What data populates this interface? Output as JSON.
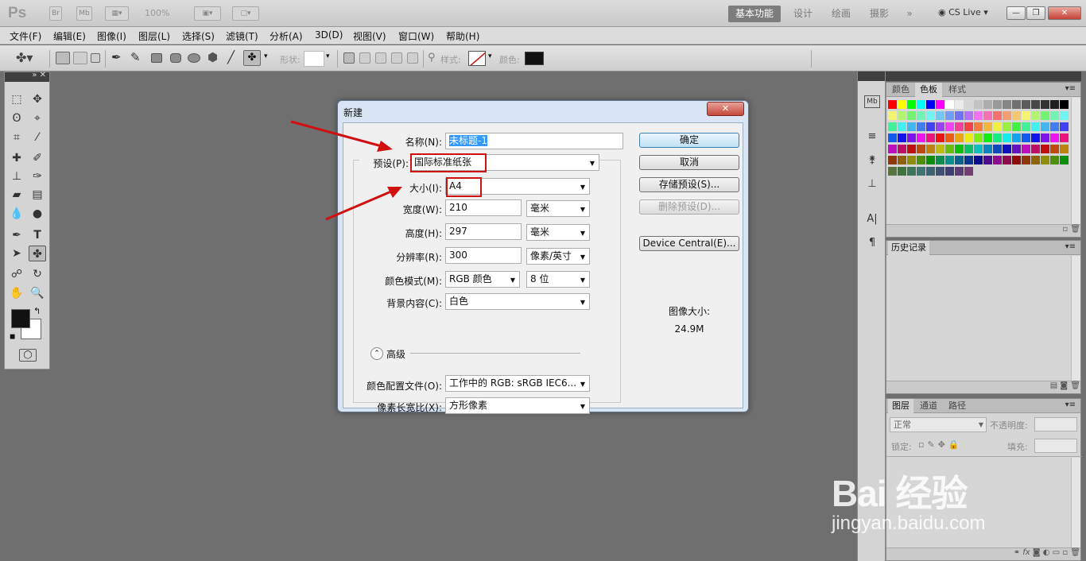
{
  "app": {
    "logo": "Ps",
    "bridge_btn": "Br",
    "mini_bridge_btn": "Mb",
    "zoom": "100%",
    "workspaces": [
      "基本功能",
      "设计",
      "绘画",
      "摄影"
    ],
    "more": "»",
    "cs_live": "CS Live",
    "window_controls": {
      "minimize": "—",
      "restore": "❐",
      "close": "✕"
    }
  },
  "menubar": [
    "文件(F)",
    "编辑(E)",
    "图像(I)",
    "图层(L)",
    "选择(S)",
    "滤镜(T)",
    "分析(A)",
    "3D(D)",
    "视图(V)",
    "窗口(W)",
    "帮助(H)"
  ],
  "options": {
    "shape_label": "形状:",
    "style_label": "样式:",
    "color_label": "颜色:",
    "color_value": "#111111"
  },
  "dialog": {
    "title": "新建",
    "close": "✕",
    "name_label": "名称(N):",
    "name_value": "未标题-1",
    "preset_label": "预设(P):",
    "preset_value": "国际标准纸张",
    "size_label": "大小(I):",
    "size_value": "A4",
    "width_label": "宽度(W):",
    "width_value": "210",
    "width_unit": "毫米",
    "height_label": "高度(H):",
    "height_value": "297",
    "height_unit": "毫米",
    "resolution_label": "分辨率(R):",
    "resolution_value": "300",
    "resolution_unit": "像素/英寸",
    "colormode_label": "颜色模式(M):",
    "colormode_value": "RGB 颜色",
    "bitdepth_value": "8 位",
    "background_label": "背景内容(C):",
    "background_value": "白色",
    "advanced_label": "高级",
    "profile_label": "颜色配置文件(O):",
    "profile_value": "工作中的 RGB: sRGB IEC6...",
    "aspect_label": "像素长宽比(X):",
    "aspect_value": "方形像素",
    "buttons": {
      "ok": "确定",
      "cancel": "取消",
      "save_preset": "存储预设(S)...",
      "delete_preset": "删除预设(D)...",
      "device_central": "Device Central(E)..."
    },
    "image_size_label": "图像大小:",
    "image_size_value": "24.9M"
  },
  "panels": {
    "swatches_tabs": [
      "颜色",
      "色板",
      "样式"
    ],
    "history_tab": "历史记录",
    "layers_tabs": [
      "图层",
      "通道",
      "路径"
    ],
    "blend_mode": "正常",
    "opacity_label": "不透明度:",
    "lock_label": "锁定:",
    "fill_label": "填充:"
  },
  "watermark": {
    "line1": "Bai 经验",
    "line2": "jingyan.baidu.com"
  },
  "colors": {
    "highlight": "#d01010",
    "arrow": "#d01010",
    "accent": "#3399ff"
  }
}
